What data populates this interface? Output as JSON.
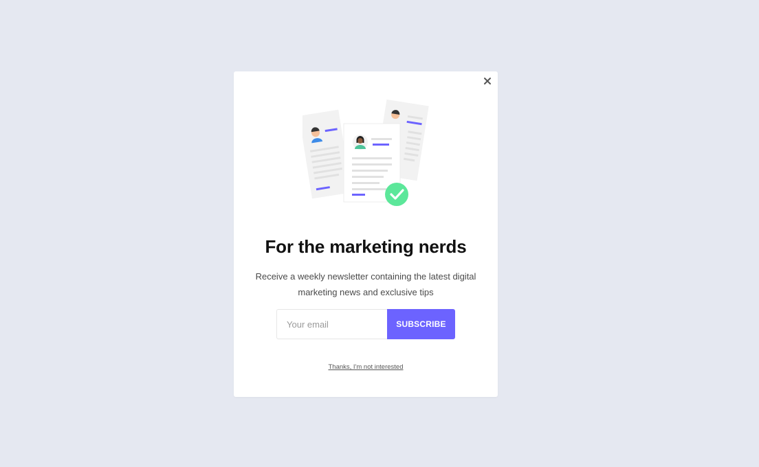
{
  "modal": {
    "close_icon": "close-icon",
    "illustration_icon": "resume-documents-illustration",
    "title": "For the marketing nerds",
    "description": "Receive a weekly newsletter containing the latest digital marketing news and exclusive tips",
    "email_placeholder": "Your email",
    "email_value": "",
    "subscribe_label": "SUBSCRIBE",
    "decline_label": "Thanks, I'm not interested"
  },
  "colors": {
    "background": "#e5e8f1",
    "accent": "#6c63ff",
    "check": "#5ce79a"
  }
}
